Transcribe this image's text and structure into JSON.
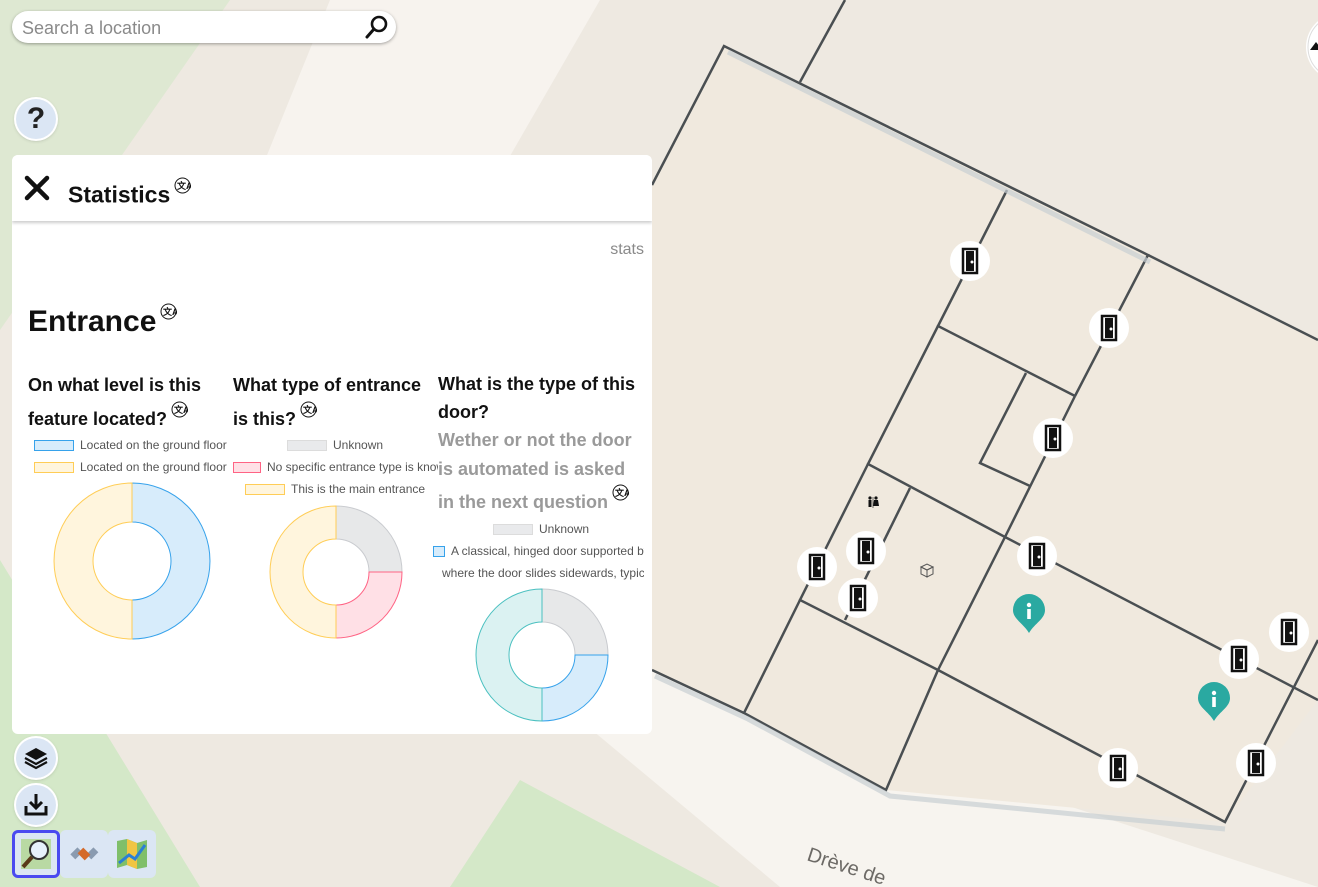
{
  "search": {
    "placeholder": "Search a location"
  },
  "help": {
    "label": "?"
  },
  "map": {
    "street_label": "Drève de"
  },
  "panel": {
    "title": "Statistics",
    "stats_label": "stats",
    "layer_title": "Entrance",
    "questions": [
      {
        "title": "On what level is this feature located?",
        "legend": [
          {
            "label": "Located on the ground floor",
            "color": "#36a2eb"
          },
          {
            "label": "Located on the ground floor",
            "color": "#ffcd56"
          }
        ]
      },
      {
        "title": "What type of entrance is this?",
        "legend": [
          {
            "label": "Unknown",
            "color": "#c9cbcf"
          },
          {
            "label": "No specific entrance type is know",
            "color": "#ff6384"
          },
          {
            "label": "This is the main entrance",
            "color": "#ffcd56"
          }
        ]
      },
      {
        "title": "What is the type of this door?",
        "subtitle": "Wether or not the door is automated is asked in the next question",
        "legend": [
          {
            "label": "Unknown",
            "color": "#c9cbcf"
          },
          {
            "label": "A classical, hinged door supported by",
            "color": "#36a2eb"
          },
          {
            "label": "where the door slides sidewards, typic",
            "color": "#4bc0c0"
          }
        ]
      }
    ]
  },
  "chart_data": [
    {
      "type": "pie",
      "title": "On what level is this feature located?",
      "categories": [
        "Located on the ground floor",
        "Located on the ground floor"
      ],
      "values": [
        1,
        1
      ]
    },
    {
      "type": "pie",
      "title": "What type of entrance is this?",
      "categories": [
        "Unknown",
        "No specific entrance type is know",
        "This is the main entrance"
      ],
      "values": [
        1,
        1,
        2
      ]
    },
    {
      "type": "pie",
      "title": "What is the type of this door?",
      "categories": [
        "Unknown",
        "A classical, hinged door supported by",
        "where the door slides sidewards, typic"
      ],
      "values": [
        1,
        1,
        2
      ]
    }
  ],
  "colors": {
    "accent": "#4a4af0",
    "marker": "#2aa9a1"
  }
}
